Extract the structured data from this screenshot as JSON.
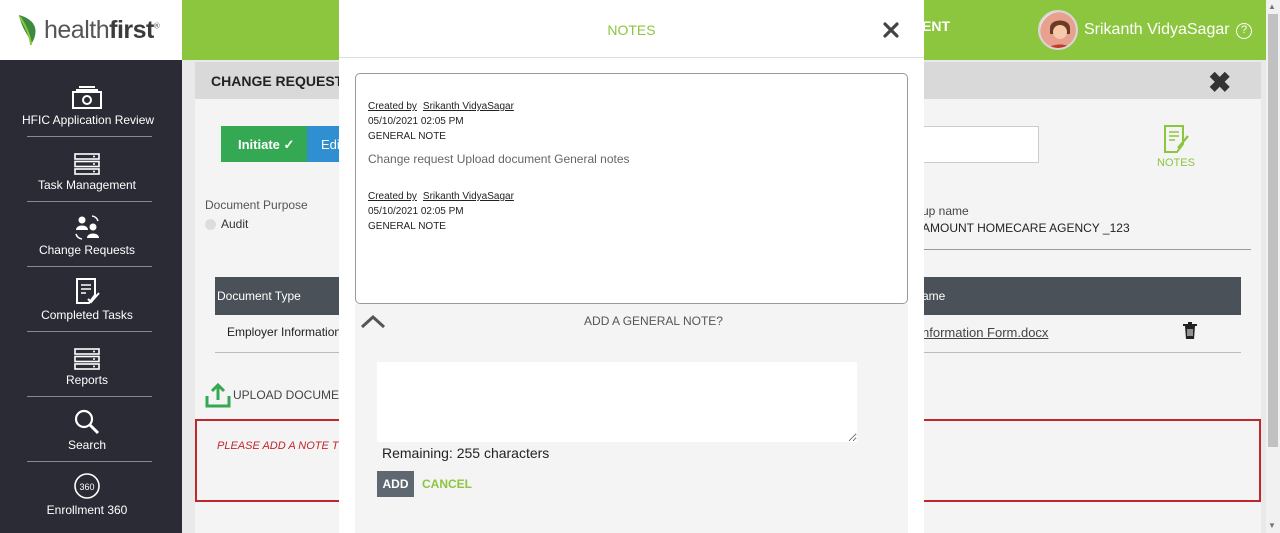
{
  "header": {
    "logo_prefix": "health",
    "logo_suffix": "first",
    "logo_mark": "®",
    "nav_fragment": "ENT",
    "user_name": "Srikanth VidyaSagar",
    "help_symbol": "?",
    "brand_color": "#8cc63f"
  },
  "sidebar": {
    "items": [
      {
        "label": "HFIC Application Review",
        "icon": "money-stack-icon"
      },
      {
        "label": "Task Management",
        "icon": "server-rack-icon"
      },
      {
        "label": "Change Requests",
        "icon": "people-exchange-icon"
      },
      {
        "label": "Completed Tasks",
        "icon": "checked-document-icon"
      },
      {
        "label": "Reports",
        "icon": "server-rack-icon"
      },
      {
        "label": "Search",
        "icon": "magnifier-icon"
      },
      {
        "label": "Enrollment 360",
        "icon": "360-icon",
        "icon_text": "360"
      }
    ]
  },
  "page": {
    "title": "CHANGE REQUEST (",
    "steps": [
      {
        "label": "Initiate",
        "done": true,
        "color": "#34a853"
      },
      {
        "label": "Edi",
        "color": "#2f8fd1"
      }
    ],
    "notes_label": "NOTES",
    "doc_purpose_label": "Document Purpose",
    "doc_purpose_option": "Audit",
    "group_name_label": "up name",
    "group_name_value": "AMOUNT HOMECARE AGENCY _123",
    "table": {
      "col_left": "Document Type",
      "col_right": "ame",
      "row_left": "Employer Information",
      "row_right": "nformation Form.docx"
    },
    "upload_label": "UPLOAD DOCUMENT",
    "warning_text": "PLEASE ADD A NOTE TO",
    "warning_color": "#c0272d"
  },
  "modal": {
    "title": "NOTES",
    "notes": [
      {
        "created_by_label": "Created by",
        "author": "Srikanth VidyaSagar",
        "datetime": "05/10/2021 02:05 PM",
        "type": "GENERAL NOTE",
        "body": "Change request Upload document General notes"
      },
      {
        "created_by_label": "Created by",
        "author": "Srikanth VidyaSagar",
        "datetime": "05/10/2021 02:05 PM",
        "type": "GENERAL NOTE",
        "body": ""
      }
    ],
    "add_section_title": "ADD A GENERAL NOTE?",
    "textarea_value": "",
    "remaining_text": "Remaining: 255 characters",
    "add_button": "ADD",
    "cancel_button": "CANCEL"
  }
}
